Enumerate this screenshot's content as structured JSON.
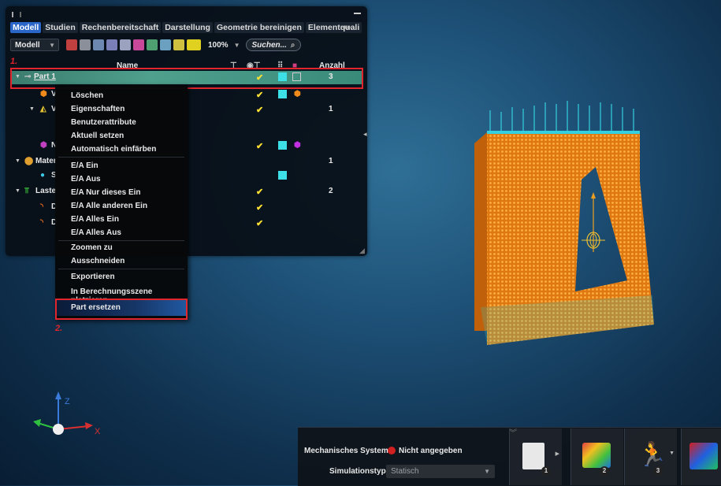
{
  "tabs": [
    "Modell",
    "Studien",
    "Rechenbereitschaft",
    "Darstellung",
    "Geometrie bereinigen",
    "Elementquali"
  ],
  "toolbar": {
    "view_dropdown": "Modell",
    "zoom": "100%",
    "search_placeholder": "Suchen..."
  },
  "columns": {
    "name": "Name",
    "count": "Anzahl"
  },
  "tree": {
    "part1": {
      "label": "Part 1",
      "count": "3"
    },
    "v1": {
      "label": "V"
    },
    "v2": {
      "label": "V",
      "count": "1"
    },
    "n": {
      "label": "N"
    },
    "mater": {
      "label": "Mater",
      "count": "1"
    },
    "s": {
      "label": "S"
    },
    "laste": {
      "label": "Laste",
      "count": "2"
    },
    "d1": {
      "label": "D"
    },
    "d2": {
      "label": "D"
    }
  },
  "check_mark": "✔",
  "markers": {
    "one": "1.",
    "two": "2."
  },
  "context_menu": [
    "Löschen",
    "Eigenschaften",
    "Benutzerattribute",
    "Aktuell setzen",
    "Automatisch einfärben",
    "E/A Ein",
    "E/A Aus",
    "E/A Nur dieses Ein",
    "E/A Alle anderen Ein",
    "E/A Alles Ein",
    "E/A Alles Aus",
    "Zoomen zu",
    "Ausschneiden",
    "Exportieren",
    "In Berechnungsszene platzieren",
    "Part ersetzen"
  ],
  "triad": {
    "z": "Z",
    "x": "X"
  },
  "bottom": {
    "mech_label": "Mechanisches System:",
    "mech_value": "Nicht angegeben",
    "sim_label": "Simulationstyp:",
    "sim_value": "Statisch",
    "tool_numbers": [
      "1",
      "2",
      "3"
    ]
  },
  "colors": {
    "highlight": "#e0252c",
    "mesh": "#f08a1a",
    "part_row": "#4fa08d",
    "active_tab": "#2a66c8",
    "check": "#ffe233"
  }
}
